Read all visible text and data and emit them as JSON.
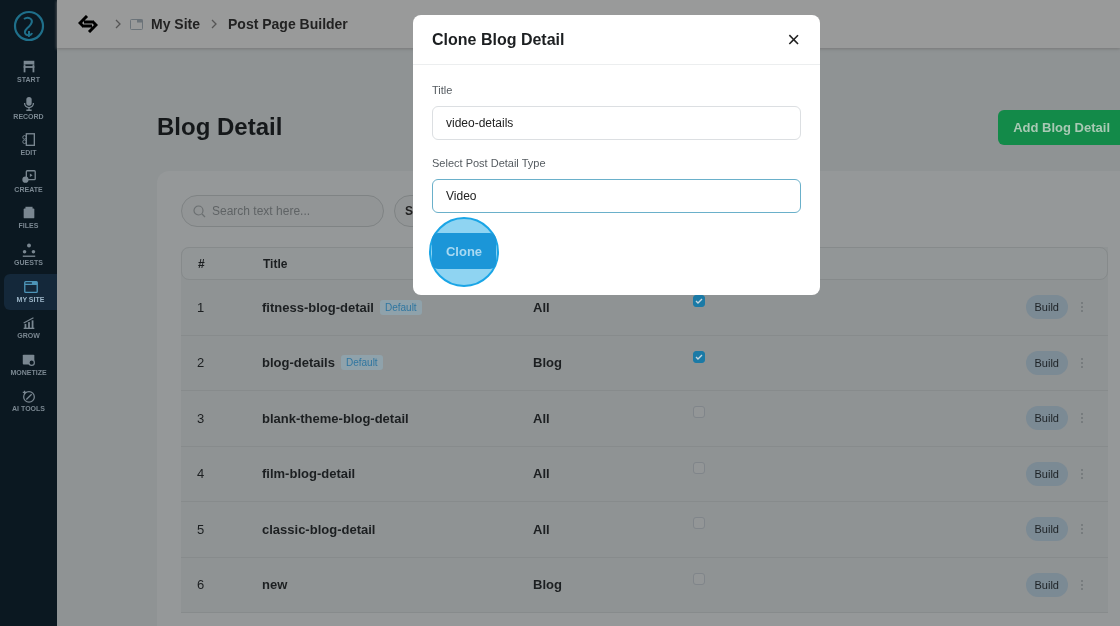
{
  "sidebar": {
    "items": [
      {
        "label": "START",
        "selected": false
      },
      {
        "label": "RECORD",
        "selected": false
      },
      {
        "label": "EDIT",
        "selected": false
      },
      {
        "label": "CREATE",
        "selected": false
      },
      {
        "label": "FILES",
        "selected": false
      },
      {
        "label": "GUESTS",
        "selected": false
      },
      {
        "label": "MY SITE",
        "selected": true
      },
      {
        "label": "GROW",
        "selected": false
      },
      {
        "label": "MONETIZE",
        "selected": false
      },
      {
        "label": "AI TOOLS",
        "selected": false
      }
    ]
  },
  "breadcrumb": [
    "My Site",
    "Post Page Builder"
  ],
  "page": {
    "title": "Blog Detail",
    "add_button": "Add Blog Detail",
    "search": {
      "placeholder": "Search text here..."
    },
    "filter_button": "S"
  },
  "table": {
    "columns": [
      "#",
      "Title"
    ],
    "rows": [
      {
        "number": "1",
        "title": "fitness-blog-detail",
        "badge": "Default",
        "type": "All",
        "checked": true,
        "action": "Build"
      },
      {
        "number": "2",
        "title": "blog-details",
        "badge": "Default",
        "type": "Blog",
        "checked": true,
        "action": "Build"
      },
      {
        "number": "3",
        "title": "blank-theme-blog-detail",
        "type": "All",
        "checked": false,
        "action": "Build"
      },
      {
        "number": "4",
        "title": "film-blog-detail",
        "type": "All",
        "checked": false,
        "action": "Build"
      },
      {
        "number": "5",
        "title": "classic-blog-detail",
        "type": "All",
        "checked": false,
        "action": "Build"
      },
      {
        "number": "6",
        "title": "new",
        "type": "Blog",
        "checked": false,
        "action": "Build"
      }
    ]
  },
  "dialog": {
    "title": "Clone Blog Detail",
    "close": "×",
    "fields": [
      {
        "label": "Title",
        "value": "video-details",
        "focused": false
      },
      {
        "label": "Select Post Detail Type",
        "value": "Video",
        "focused": true
      }
    ],
    "button": "Clone"
  }
}
